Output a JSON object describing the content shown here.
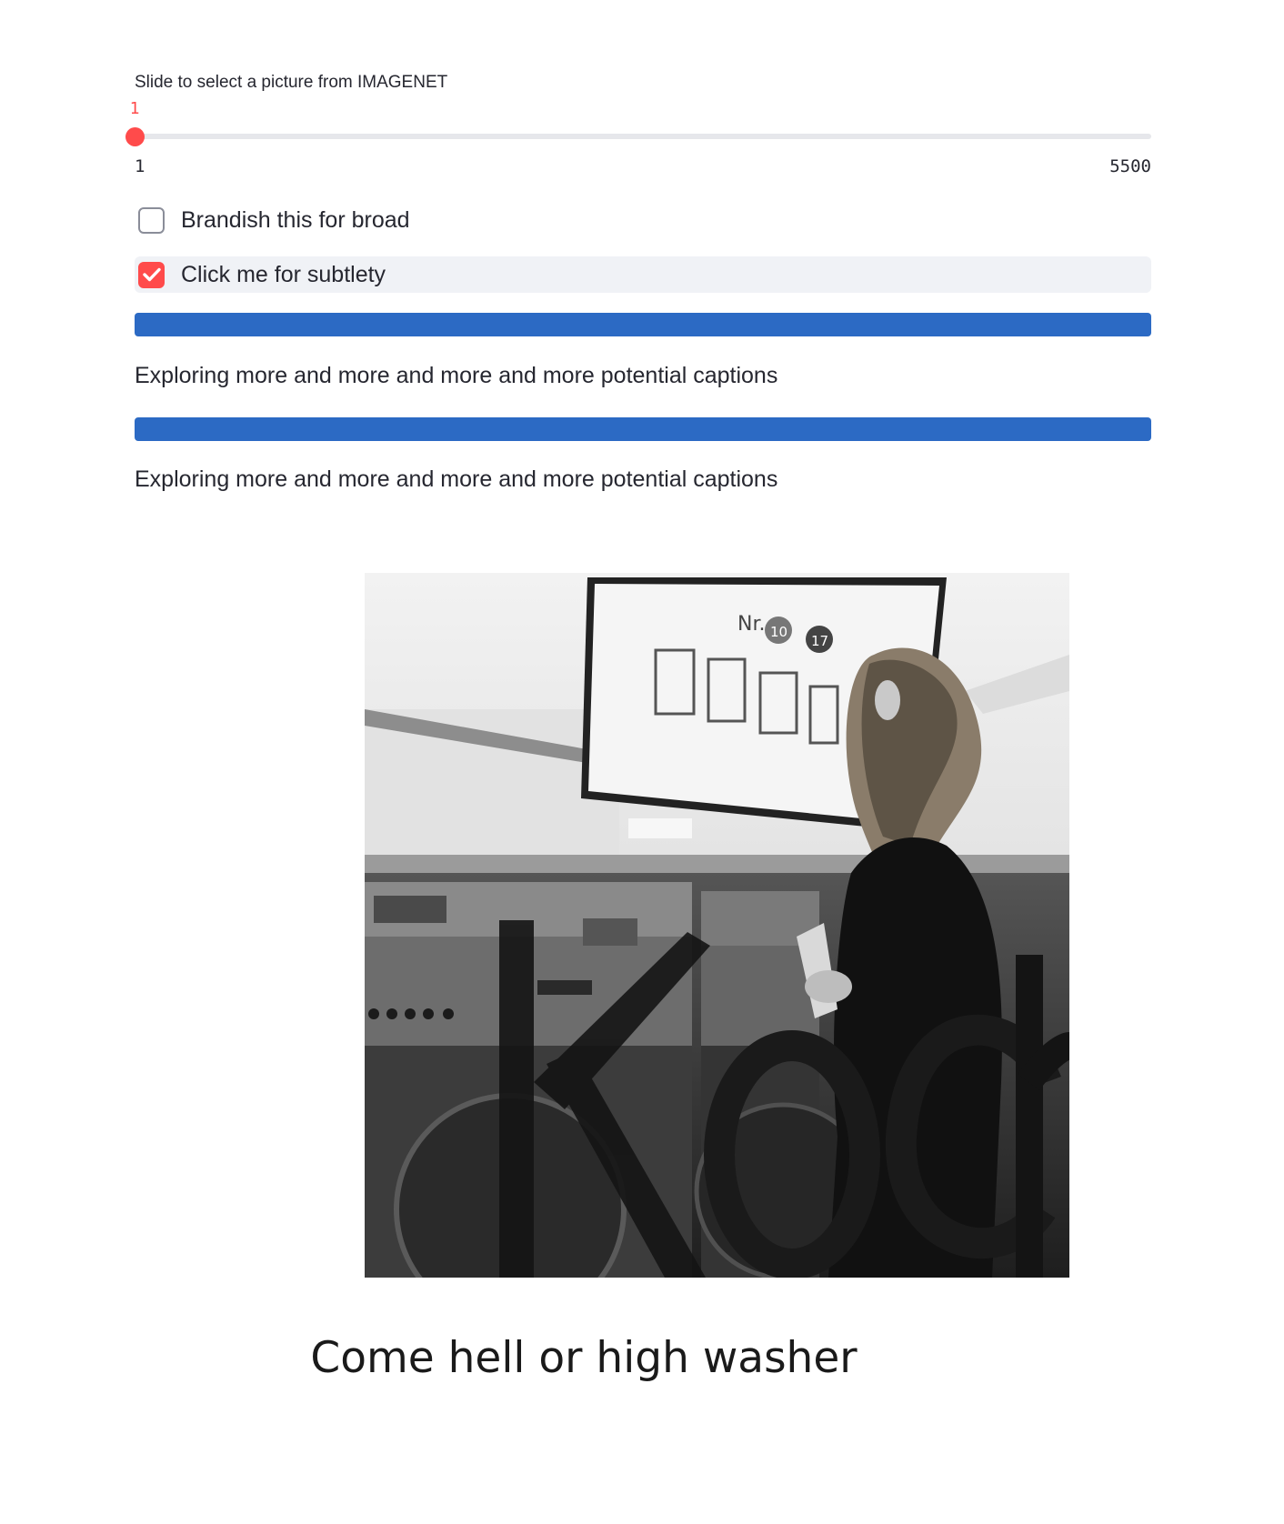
{
  "slider": {
    "label": "Slide to select a picture from IMAGENET",
    "current_value": "1",
    "min_label": "1",
    "max_label": "5500",
    "value": 1,
    "min": 1,
    "max": 5500,
    "accent_color": "#ff4b4b"
  },
  "checkboxes": [
    {
      "label": "Brandish this for broad",
      "checked": false
    },
    {
      "label": "Click me for subtlety",
      "checked": true
    }
  ],
  "progress": [
    {
      "fraction": 1.0,
      "status": "Exploring more and more and more and more potential captions"
    },
    {
      "fraction": 1.0,
      "status": "Exploring more and more and more and more potential captions"
    }
  ],
  "progress_color": "#2c6ac4",
  "image": {
    "description_icon": "laundromat-photo",
    "sign_text": "Nr.",
    "sign_badge_1": "10",
    "sign_badge_2": "17",
    "overlay_letters": "Koch"
  },
  "caption": "Come hell or high washer"
}
